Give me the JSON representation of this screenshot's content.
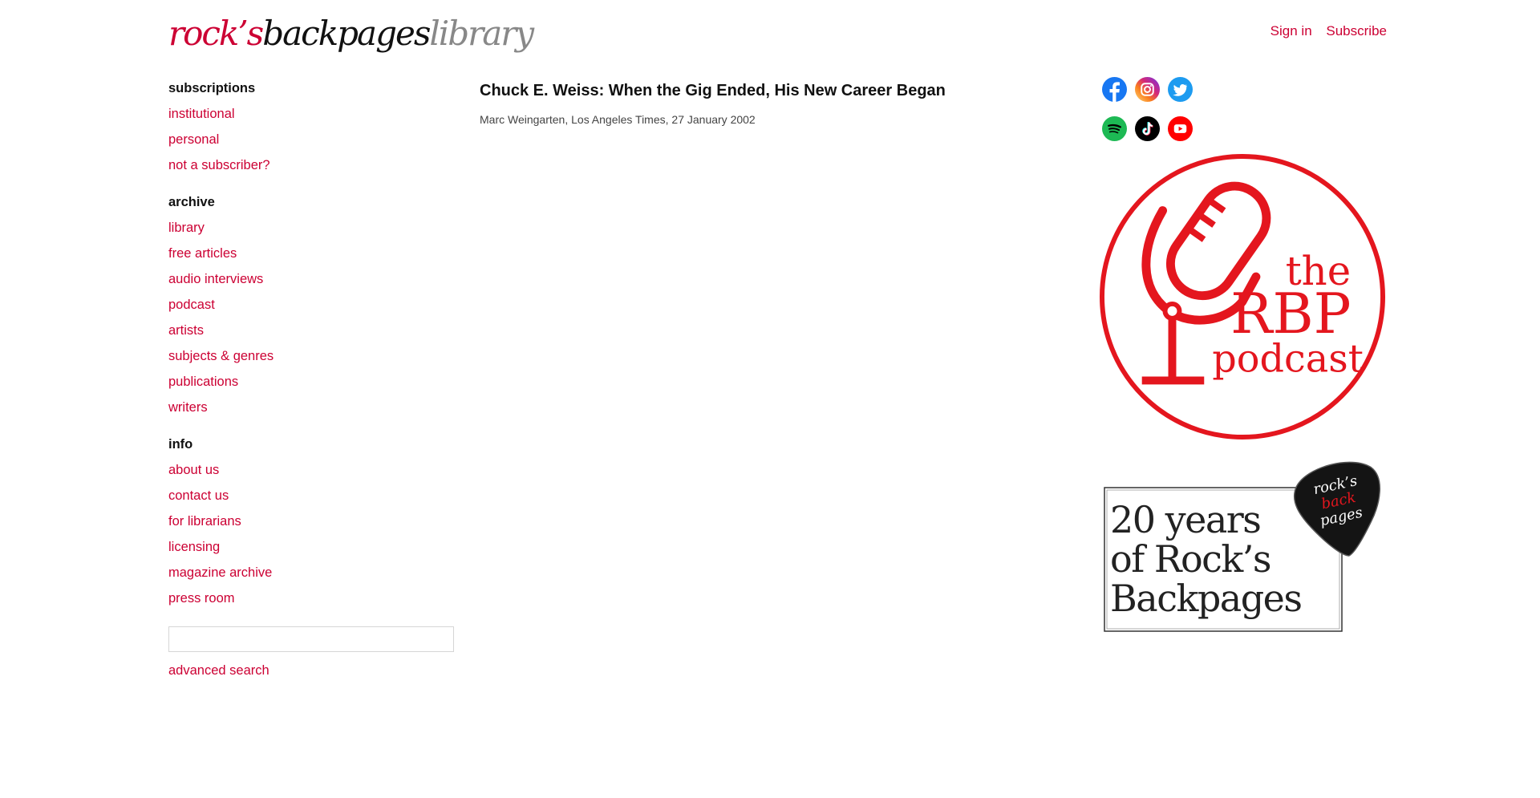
{
  "logo": {
    "part1": "rock’s",
    "part2": "backpages",
    "part3": "library"
  },
  "header": {
    "signin": "Sign in",
    "subscribe": "Subscribe"
  },
  "sidebar": {
    "subscriptions": {
      "heading": "subscriptions",
      "items": [
        "institutional",
        "personal",
        "not a subscriber?"
      ]
    },
    "archive": {
      "heading": "archive",
      "items": [
        "library",
        "free articles",
        "audio interviews",
        "podcast",
        "artists",
        "subjects & genres",
        "publications",
        "writers"
      ]
    },
    "info": {
      "heading": "info",
      "items": [
        "about us",
        "contact us",
        "for librarians",
        "licensing",
        "magazine archive",
        "press room"
      ]
    },
    "search": {
      "placeholder": "",
      "advanced": "advanced search"
    }
  },
  "article": {
    "title": "Chuck E. Weiss: When the Gig Ended, His New Career Began",
    "byline": "Marc Weingarten, Los Angeles Times, 27 January 2002"
  },
  "social": {
    "row1": [
      "facebook-icon",
      "instagram-icon",
      "twitter-icon"
    ],
    "row2": [
      "spotify-icon",
      "tiktok-icon",
      "youtube-icon"
    ]
  },
  "podcast_banner": {
    "line1": "the",
    "line2": "RBP",
    "line3": "podcast"
  },
  "anniversary_banner": {
    "line1": "20 years",
    "line2": "of Rock’s",
    "line3": "Backpages",
    "pick_line1": "rock’s",
    "pick_line2": "back",
    "pick_line3": "pages"
  },
  "colors": {
    "accent": "#cc0033",
    "podcast_red": "#e4161e",
    "text": "#111111",
    "muted": "#888888"
  }
}
